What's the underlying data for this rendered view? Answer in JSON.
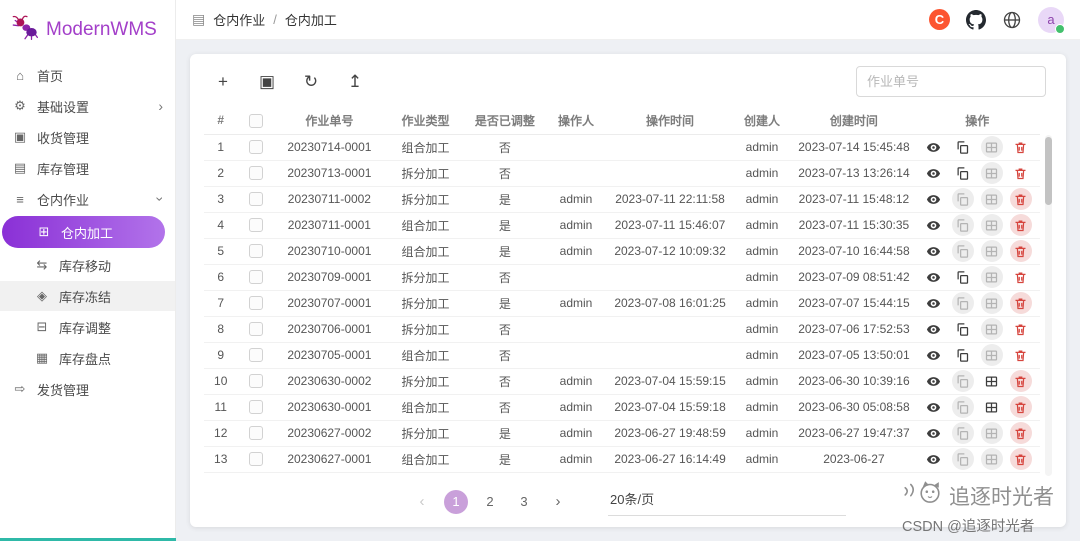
{
  "app": {
    "title": "ModernWMS"
  },
  "colors": {
    "accent": "#8a30d6",
    "accent_gradient_end": "#b273ea",
    "danger": "#d6453e",
    "csdn_brand": "#fc5531",
    "bottom_line": "#2fb9a8"
  },
  "sidebar": {
    "logo_text": "ModernWMS",
    "items": [
      {
        "id": "home",
        "label": "首页",
        "icon": "home-icon",
        "level": 1
      },
      {
        "id": "settings",
        "label": "基础设置",
        "icon": "gear-icon",
        "level": 1,
        "chevron": "right"
      },
      {
        "id": "receive",
        "label": "收货管理",
        "icon": "receive-icon",
        "level": 1
      },
      {
        "id": "inventory",
        "label": "库存管理",
        "icon": "inventory-icon",
        "level": 1
      },
      {
        "id": "warehouse-ops",
        "label": "仓内作业",
        "icon": "warehouse-icon",
        "level": 1,
        "chevron": "down"
      },
      {
        "id": "processing",
        "label": "仓内加工",
        "icon": "process-icon",
        "level": 2,
        "active": true
      },
      {
        "id": "stock-move",
        "label": "库存移动",
        "icon": "move-icon",
        "level": 2
      },
      {
        "id": "stock-freeze",
        "label": "库存冻结",
        "icon": "freeze-icon",
        "level": 2,
        "highlight": true
      },
      {
        "id": "stock-adjust",
        "label": "库存调整",
        "icon": "adjust-icon",
        "level": 2
      },
      {
        "id": "stock-count",
        "label": "库存盘点",
        "icon": "count-icon",
        "level": 2
      },
      {
        "id": "delivery",
        "label": "发货管理",
        "icon": "delivery-icon",
        "level": 1
      }
    ]
  },
  "header": {
    "breadcrumb": {
      "section": "仓内作业",
      "separator": "/",
      "page": "仓内加工"
    },
    "avatar_text": "a"
  },
  "toolbar": {
    "search_placeholder": "作业单号"
  },
  "table": {
    "columns": [
      "#",
      "作业单号",
      "作业类型",
      "是否已调整",
      "操作人",
      "操作时间",
      "创建人",
      "创建时间",
      "操作"
    ],
    "rows": [
      {
        "index": "1",
        "job_no": "20230714-0001",
        "job_type": "组合加工",
        "adjusted": "否",
        "operator": "",
        "operate_time": "",
        "creator": "admin",
        "create_time": "2023-07-14 15:45:48",
        "actions": {
          "copy_enabled": true,
          "adjust_enabled": false,
          "delete_plain": true
        }
      },
      {
        "index": "2",
        "job_no": "20230713-0001",
        "job_type": "拆分加工",
        "adjusted": "否",
        "operator": "",
        "operate_time": "",
        "creator": "admin",
        "create_time": "2023-07-13 13:26:14",
        "actions": {
          "copy_enabled": true,
          "adjust_enabled": false,
          "delete_plain": true
        }
      },
      {
        "index": "3",
        "job_no": "20230711-0002",
        "job_type": "拆分加工",
        "adjusted": "是",
        "operator": "admin",
        "operate_time": "2023-07-11 22:11:58",
        "creator": "admin",
        "create_time": "2023-07-11 15:48:12",
        "actions": {
          "copy_enabled": false,
          "adjust_enabled": false,
          "delete_plain": false
        }
      },
      {
        "index": "4",
        "job_no": "20230711-0001",
        "job_type": "组合加工",
        "adjusted": "是",
        "operator": "admin",
        "operate_time": "2023-07-11 15:46:07",
        "creator": "admin",
        "create_time": "2023-07-11 15:30:35",
        "actions": {
          "copy_enabled": false,
          "adjust_enabled": false,
          "delete_plain": false
        }
      },
      {
        "index": "5",
        "job_no": "20230710-0001",
        "job_type": "组合加工",
        "adjusted": "是",
        "operator": "admin",
        "operate_time": "2023-07-12 10:09:32",
        "creator": "admin",
        "create_time": "2023-07-10 16:44:58",
        "actions": {
          "copy_enabled": false,
          "adjust_enabled": false,
          "delete_plain": false
        }
      },
      {
        "index": "6",
        "job_no": "20230709-0001",
        "job_type": "拆分加工",
        "adjusted": "否",
        "operator": "",
        "operate_time": "",
        "creator": "admin",
        "create_time": "2023-07-09 08:51:42",
        "actions": {
          "copy_enabled": true,
          "adjust_enabled": false,
          "delete_plain": true
        }
      },
      {
        "index": "7",
        "job_no": "20230707-0001",
        "job_type": "拆分加工",
        "adjusted": "是",
        "operator": "admin",
        "operate_time": "2023-07-08 16:01:25",
        "creator": "admin",
        "create_time": "2023-07-07 15:44:15",
        "actions": {
          "copy_enabled": false,
          "adjust_enabled": false,
          "delete_plain": false
        }
      },
      {
        "index": "8",
        "job_no": "20230706-0001",
        "job_type": "拆分加工",
        "adjusted": "否",
        "operator": "",
        "operate_time": "",
        "creator": "admin",
        "create_time": "2023-07-06 17:52:53",
        "actions": {
          "copy_enabled": true,
          "adjust_enabled": false,
          "delete_plain": true
        }
      },
      {
        "index": "9",
        "job_no": "20230705-0001",
        "job_type": "组合加工",
        "adjusted": "否",
        "operator": "",
        "operate_time": "",
        "creator": "admin",
        "create_time": "2023-07-05 13:50:01",
        "actions": {
          "copy_enabled": true,
          "adjust_enabled": false,
          "delete_plain": true
        }
      },
      {
        "index": "10",
        "job_no": "20230630-0002",
        "job_type": "拆分加工",
        "adjusted": "否",
        "operator": "admin",
        "operate_time": "2023-07-04 15:59:15",
        "creator": "admin",
        "create_time": "2023-06-30 10:39:16",
        "actions": {
          "copy_enabled": false,
          "adjust_enabled": true,
          "delete_plain": false
        }
      },
      {
        "index": "11",
        "job_no": "20230630-0001",
        "job_type": "组合加工",
        "adjusted": "否",
        "operator": "admin",
        "operate_time": "2023-07-04 15:59:18",
        "creator": "admin",
        "create_time": "2023-06-30 05:08:58",
        "actions": {
          "copy_enabled": false,
          "adjust_enabled": true,
          "delete_plain": false
        }
      },
      {
        "index": "12",
        "job_no": "20230627-0002",
        "job_type": "拆分加工",
        "adjusted": "是",
        "operator": "admin",
        "operate_time": "2023-06-27 19:48:59",
        "creator": "admin",
        "create_time": "2023-06-27 19:47:37",
        "actions": {
          "copy_enabled": false,
          "adjust_enabled": false,
          "delete_plain": false
        }
      },
      {
        "index": "13",
        "job_no": "20230627-0001",
        "job_type": "组合加工",
        "adjusted": "是",
        "operator": "admin",
        "operate_time": "2023-06-27 16:14:49",
        "creator": "admin",
        "create_time": "2023-06-27",
        "actions": {
          "copy_enabled": false,
          "adjust_enabled": false,
          "delete_plain": false
        }
      }
    ]
  },
  "pagination": {
    "pages": [
      "1",
      "2",
      "3"
    ],
    "current": "1",
    "page_size": "20条/页"
  },
  "watermark": {
    "line1": "追逐时光者",
    "line2": "CSDN @追逐时光者"
  }
}
